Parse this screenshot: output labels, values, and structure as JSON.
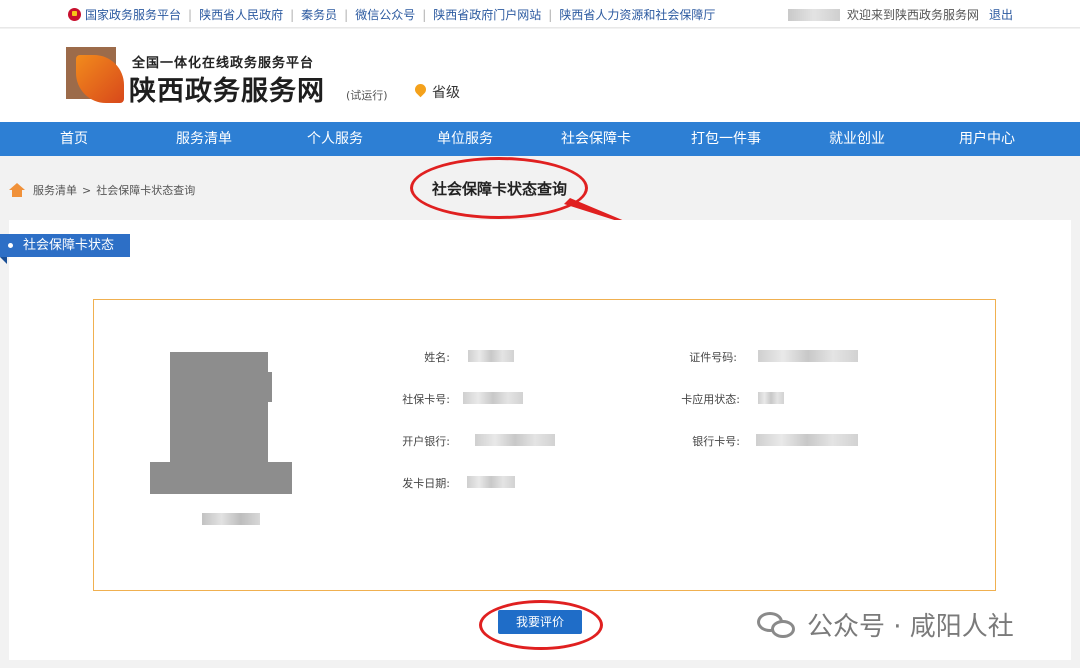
{
  "topbar": {
    "links": [
      "国家政务服务平台",
      "陕西省人民政府",
      "秦务员",
      "微信公众号",
      "陕西省政府门户网站",
      "陕西省人力资源和社会保障厅"
    ],
    "welcome": "欢迎来到陕西政务服务网",
    "logout": "退出"
  },
  "header": {
    "subtitle": "全国一体化在线政务服务平台",
    "site_name": "陕西政务服务网",
    "trial": "(试运行)",
    "level": "省级"
  },
  "nav": {
    "items": [
      "首页",
      "服务清单",
      "个人服务",
      "单位服务",
      "社会保障卡",
      "打包一件事",
      "就业创业",
      "用户中心"
    ]
  },
  "breadcrumb": {
    "parent": "服务清单",
    "separator": ">",
    "current": "社会保障卡状态查询"
  },
  "page_title": "社会保障卡状态查询",
  "section_tag": "社会保障卡状态",
  "fields": {
    "name_label": "姓名:",
    "id_label": "证件号码:",
    "card_no_label": "社保卡号:",
    "status_label": "卡应用状态:",
    "bank_label": "开户银行:",
    "bank_card_label": "银行卡号:",
    "issue_date_label": "发卡日期:"
  },
  "evaluate_button": "我要评价",
  "watermark": "公众号 · 咸阳人社",
  "colors": {
    "nav_bg": "#2d7fd4",
    "tag_bg": "#2d6fc6",
    "button_bg": "#1f6dc8",
    "annotation_red": "#e02020",
    "box_border": "#f0b050"
  }
}
